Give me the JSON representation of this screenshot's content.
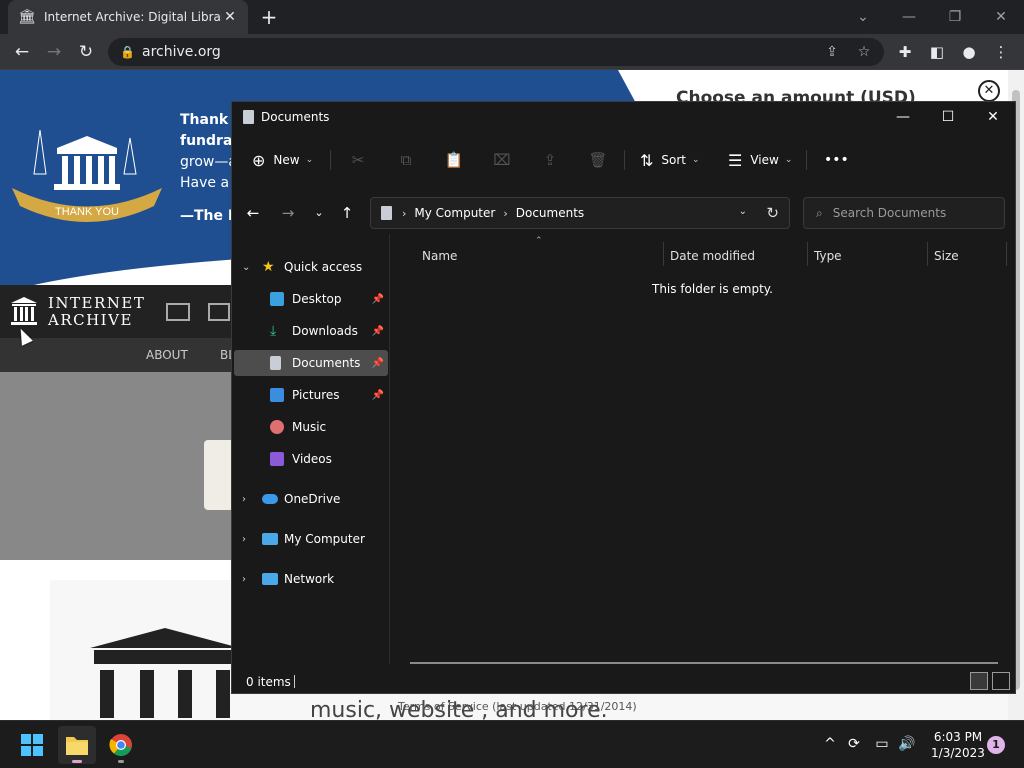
{
  "chrome": {
    "tab_title": "Internet Archive: Digital Library of Free & Borrowable Books, Movies, Music & Wayback Machine",
    "url": "archive.org"
  },
  "page": {
    "banner_text": [
      "Thank y",
      "fundrais",
      "grow—a",
      "Have a v"
    ],
    "banner_sign": "—The Ir",
    "seal_text": "THANK YOU",
    "amount_title": "Choose an amount (USD)",
    "logo_line1": "INTERNET",
    "logo_line2": "ARCHIVE",
    "subnav_about": "ABOUT",
    "subnav_bl": "BL",
    "footer_terms": "Terms of Service (last updated 12/31/2014)",
    "footer_fragment": "music, website , and more."
  },
  "explorer": {
    "title": "Documents",
    "cmd": {
      "new": "New",
      "sort": "Sort",
      "view": "View",
      "more": "•••"
    },
    "breadcrumb": [
      "My Computer",
      "Documents"
    ],
    "search_placeholder": "Search Documents",
    "nav": {
      "quick_access": "Quick access",
      "desktop": "Desktop",
      "downloads": "Downloads",
      "documents": "Documents",
      "pictures": "Pictures",
      "music": "Music",
      "videos": "Videos",
      "onedrive": "OneDrive",
      "my_computer": "My Computer",
      "network": "Network"
    },
    "columns": {
      "name": "Name",
      "date_modified": "Date modified",
      "type": "Type",
      "size": "Size"
    },
    "empty_message": "This folder is empty.",
    "status": "0 items"
  },
  "taskbar": {
    "time": "6:03 PM",
    "date": "1/3/2023",
    "notifications": "1"
  },
  "colors": {
    "banner_blue": "#1f4f91",
    "explorer_bg": "#191919",
    "accent": "#4cc2ff"
  }
}
